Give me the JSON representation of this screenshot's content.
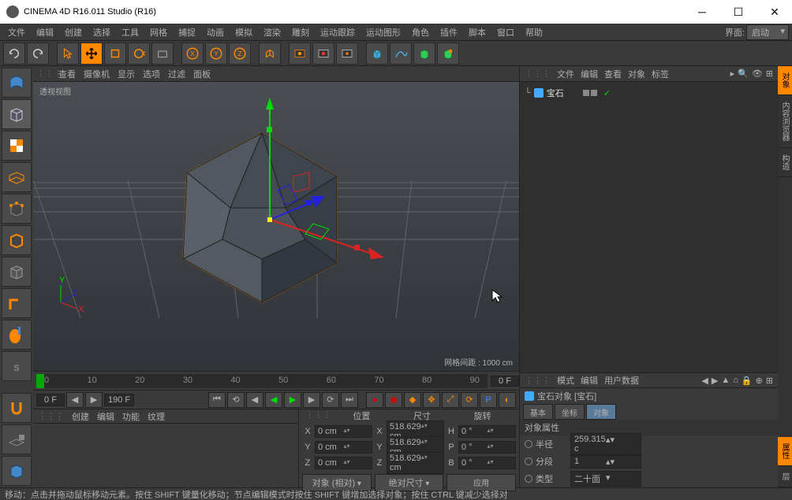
{
  "window": {
    "title": "CINEMA 4D R16.011 Studio (R16)"
  },
  "menus": [
    "文件",
    "编辑",
    "创建",
    "选择",
    "工具",
    "网格",
    "捕捉",
    "动画",
    "模拟",
    "渲染",
    "雕刻",
    "运动跟踪",
    "运动图形",
    "角色",
    "插件",
    "脚本",
    "窗口",
    "帮助"
  ],
  "layout_label": "界面:",
  "layout_value": "启动",
  "view_header": [
    "查看",
    "摄像机",
    "显示",
    "选项",
    "过滤",
    "面板"
  ],
  "viewport_label": "透视视图",
  "grid_info": "网格间距 : 1000 cm",
  "timeline": {
    "start": "0",
    "end": "90",
    "end_field": "0 F",
    "ticks": [
      "0",
      "10",
      "20",
      "30",
      "40",
      "50",
      "60",
      "70",
      "80",
      "90"
    ]
  },
  "playbar": {
    "cur": "0 F",
    "end": "190 F"
  },
  "lower_left_menu": [
    "创建",
    "编辑",
    "功能",
    "纹理"
  ],
  "coord": {
    "headers": [
      "位置",
      "尺寸",
      "旋转"
    ],
    "rows": [
      {
        "axis": "X",
        "pos": "0 cm",
        "size": "518.629 cm",
        "rot_lbl": "H",
        "rot": "0 °"
      },
      {
        "axis": "Y",
        "pos": "0 cm",
        "size": "518.629 cm",
        "rot_lbl": "P",
        "rot": "0 °"
      },
      {
        "axis": "Z",
        "pos": "0 cm",
        "size": "518.629 cm",
        "rot_lbl": "B",
        "rot": "0 °"
      }
    ],
    "btn1": "对象 (相对)",
    "btn2": "绝对尺寸",
    "btn3": "应用"
  },
  "obj_header": [
    "文件",
    "编辑",
    "查看",
    "对象",
    "标签"
  ],
  "obj_name": "宝石",
  "attr_header": [
    "模式",
    "编辑",
    "用户数据"
  ],
  "attr_title": "宝石对象 [宝石]",
  "attr_tabs": [
    "基本",
    "坐标",
    "对象"
  ],
  "attr_section": "对象属性",
  "attr_rows": [
    {
      "label": "半径",
      "value": "259.315 c"
    },
    {
      "label": "分段",
      "value": "1"
    },
    {
      "label": "类型",
      "value": "二十面"
    }
  ],
  "right_tabs": [
    "对象",
    "内容浏览器",
    "构造"
  ],
  "attr_side_tab": "属性",
  "status": "移动：点击并拖动鼠标移动元素。按住 SHIFT 键量化移动；节点编辑模式时按住 SHIFT 键增加选择对象；按住 CTRL 键减少选择对"
}
